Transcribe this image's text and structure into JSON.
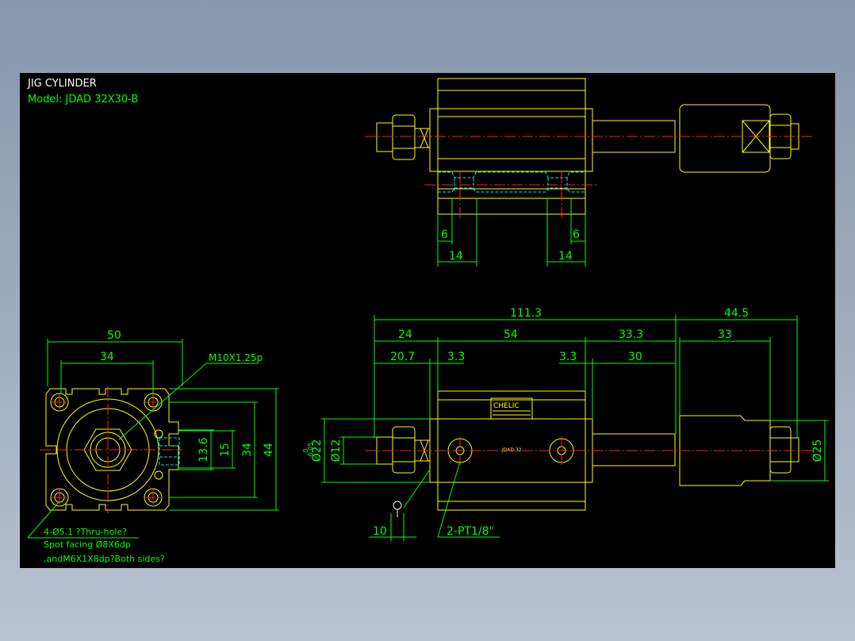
{
  "drawing": {
    "title": "JIG CYLINDER",
    "model": "Model:  JDAD 32X30-B",
    "brand": "CHELIC",
    "label_small": "JDAD 32",
    "colors": {
      "background": "#000000",
      "outline": "#ffff00",
      "dimension": "#00ff00",
      "centerline": "#ff2020",
      "hidden": "#00e5ff",
      "text": "#ffffff"
    }
  },
  "top_view": {
    "dims": [
      "6",
      "6",
      "14",
      "14"
    ]
  },
  "end_view": {
    "dims": [
      "50",
      "34",
      "13.6",
      "15",
      "34",
      "44"
    ],
    "thread_callout": "M10X1.25p",
    "notes": [
      "4-Ø5.1 ?Thru-hole?",
      "Spot facing  Ø8X6dp",
      ",andM6X1X8dp?Both sides?"
    ]
  },
  "side_view": {
    "dims_top": [
      "111.3",
      "44.5"
    ],
    "dims_mid": [
      "24",
      "54",
      "33.3",
      "33"
    ],
    "dims_low": [
      "20.7",
      "3.3",
      "3.3",
      "30"
    ],
    "dia_left": [
      "Ø22",
      "-0.05",
      "0"
    ],
    "dia_rod": "Ø12",
    "dia_right": "Ø25",
    "dim_bottom": "10",
    "port_callout": "2-PT1/8\""
  }
}
